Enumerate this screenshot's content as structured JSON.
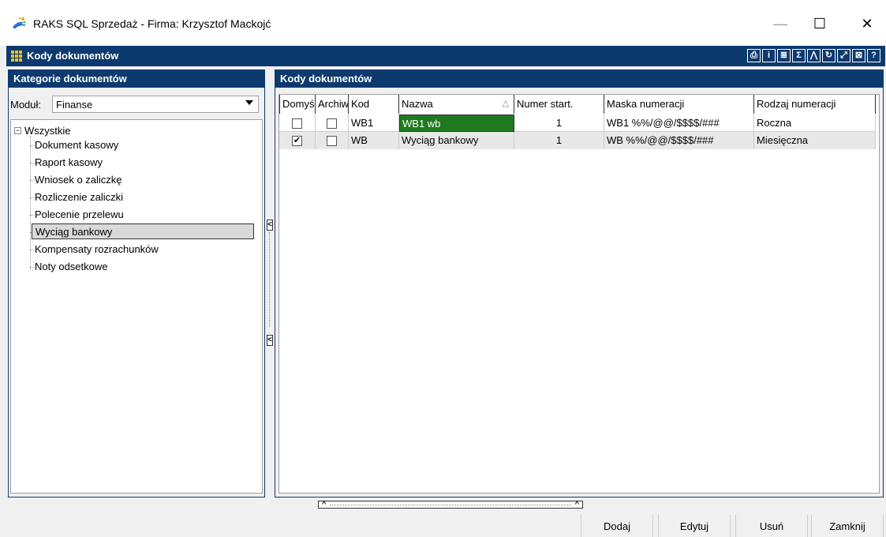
{
  "window": {
    "title": "RAKS SQL Sprzedaż - Firma: Krzysztof Mackojć",
    "minimize_glyph": "—",
    "maximize_glyph": "☐",
    "close_glyph": "✕"
  },
  "module_window": {
    "title": "Kody dokumentów",
    "toolbar_icons": [
      {
        "name": "print-icon",
        "glyph": "⎙"
      },
      {
        "name": "info-icon",
        "glyph": "i"
      },
      {
        "name": "list-icon",
        "glyph": "≣"
      },
      {
        "name": "sum-icon",
        "glyph": "Σ"
      },
      {
        "name": "filter-icon",
        "glyph": "⋀"
      },
      {
        "name": "refresh-icon",
        "glyph": "↻"
      },
      {
        "name": "resize-icon",
        "glyph": "⤢"
      },
      {
        "name": "close-window-icon",
        "glyph": "⊠"
      },
      {
        "name": "help-icon",
        "glyph": "?"
      }
    ]
  },
  "left_panel": {
    "title": "Kategorie dokumentów",
    "module_label": "Moduł:",
    "module_value": "Finanse",
    "tree_root": "Wszystkie",
    "tree_root_toggle": "−",
    "tree_items": [
      "Dokument kasowy",
      "Raport kasowy",
      "Wniosek o zaliczkę",
      "Rozliczenie zaliczki",
      "Polecenie przelewu",
      "Wyciąg bankowy",
      "Kompensaty rozrachunków",
      "Noty odsetkowe"
    ],
    "selected_index": 5
  },
  "right_panel": {
    "title": "Kody dokumentów",
    "columns": [
      "Domyś",
      "Archiw",
      "Kod",
      "Nazwa",
      "Numer start.",
      "Maska numeracji",
      "Rodzaj numeracji"
    ],
    "sort_glyph": "△",
    "rows": [
      {
        "domyslny": false,
        "archiwalny": false,
        "kod": "WB1",
        "nazwa": "WB1 wb",
        "numer_start": "1",
        "maska": "WB1 %%/@@/$$$$/###",
        "rodzaj": "Roczna"
      },
      {
        "domyslny": true,
        "archiwalny": false,
        "kod": "WB",
        "nazwa": "Wyciąg bankowy",
        "numer_start": "1",
        "maska": "WB %%/@@/$$$$/###",
        "rodzaj": "Miesięczna"
      }
    ],
    "check_glyph": "✔"
  },
  "splitter": {
    "collapse_glyph": "<",
    "up_glyph": "^"
  },
  "buttons": {
    "add": "Dodaj",
    "edit": "Edytuj",
    "delete": "Usuń",
    "close": "Zamknij"
  },
  "colors": {
    "header_blue": "#0d3a6e",
    "selected_green": "#1f7a1f"
  }
}
